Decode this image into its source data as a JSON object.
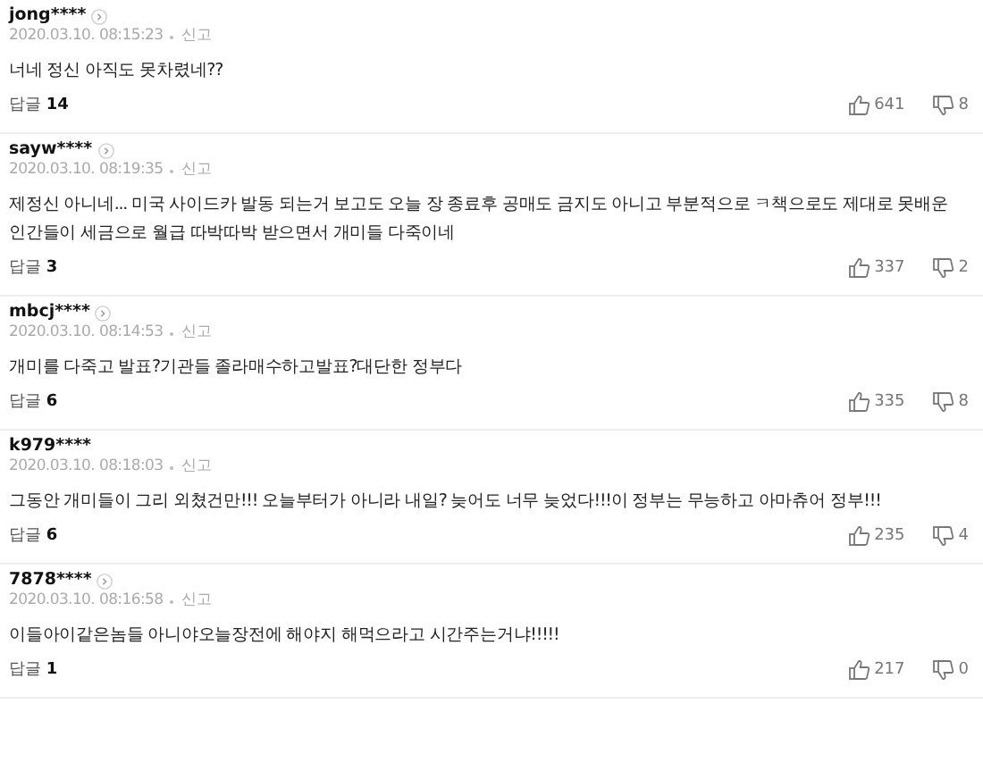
{
  "comments": [
    {
      "user": "jong****",
      "profile_link": true,
      "date": "2020.03.10. 08:15:23",
      "report": "신고",
      "text": "너네 정신 아직도 못차렸네??",
      "reply_label": "답글",
      "reply_count": "14",
      "likes": "641",
      "dislikes": "8"
    },
    {
      "user": "sayw****",
      "profile_link": true,
      "date": "2020.03.10. 08:19:35",
      "report": "신고",
      "text": "제정신 아니네... 미국 사이드카 발동 되는거 보고도 오늘 장 종료후 공매도 금지도 아니고 부분적으로 ㅋ책으로도 제대로 못배운 인간들이 세금으로 월급 따박따박 받으면서 개미들 다죽이네",
      "reply_label": "답글",
      "reply_count": "3",
      "likes": "337",
      "dislikes": "2"
    },
    {
      "user": "mbcj****",
      "profile_link": true,
      "date": "2020.03.10. 08:14:53",
      "report": "신고",
      "text": "개미를 다죽고 발표?기관들 졸라매수하고발표?대단한 정부다",
      "reply_label": "답글",
      "reply_count": "6",
      "likes": "335",
      "dislikes": "8"
    },
    {
      "user": "k979****",
      "profile_link": false,
      "date": "2020.03.10. 08:18:03",
      "report": "신고",
      "text": "그동안 개미들이 그리 외쳤건만!!! 오늘부터가 아니라 내일? 늦어도 너무 늦었다!!!이 정부는 무능하고 아마츄어 정부!!!",
      "reply_label": "답글",
      "reply_count": "6",
      "likes": "235",
      "dislikes": "4"
    },
    {
      "user": "7878****",
      "profile_link": true,
      "date": "2020.03.10. 08:16:58",
      "report": "신고",
      "text": "이들아이같은놈들 아니야오늘장전에 해야지 해먹으라고 시간주는거냐!!!!!",
      "reply_label": "답글",
      "reply_count": "1",
      "likes": "217",
      "dislikes": "0"
    }
  ]
}
